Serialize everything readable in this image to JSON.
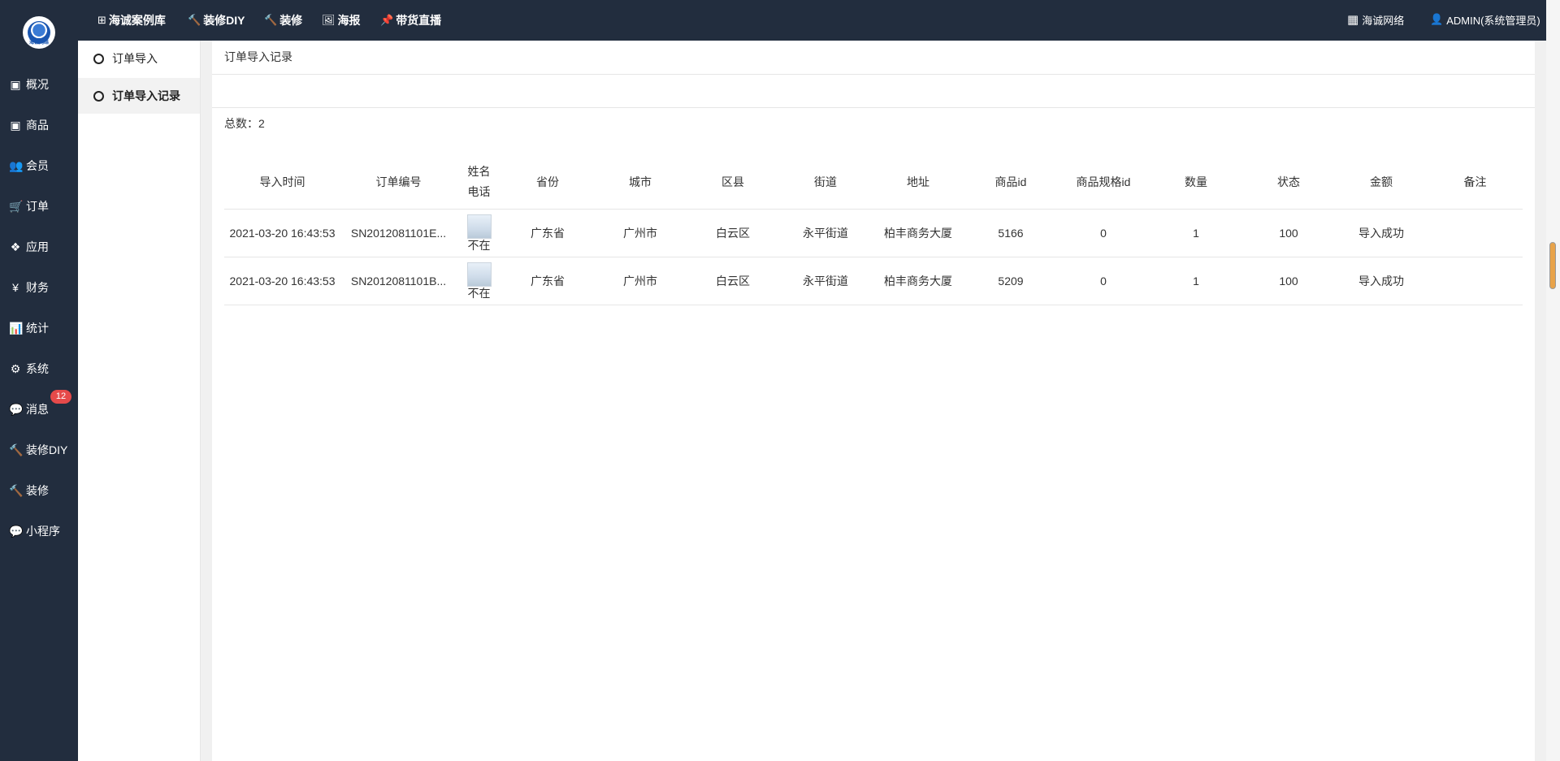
{
  "sidebar": {
    "logo_text": "海诚网络",
    "items": [
      {
        "label": "概况",
        "icon": "archive-icon",
        "glyph": "▣"
      },
      {
        "label": "商品",
        "icon": "box-icon",
        "glyph": "▣"
      },
      {
        "label": "会员",
        "icon": "users-icon",
        "glyph": "👥"
      },
      {
        "label": "订单",
        "icon": "cart-icon",
        "glyph": "🛒"
      },
      {
        "label": "应用",
        "icon": "cubes-icon",
        "glyph": "❖"
      },
      {
        "label": "财务",
        "icon": "yen-icon",
        "glyph": "¥"
      },
      {
        "label": "统计",
        "icon": "bar-chart-icon",
        "glyph": "📊"
      },
      {
        "label": "系统",
        "icon": "gears-icon",
        "glyph": "⚙"
      },
      {
        "label": "消息",
        "icon": "chat-icon",
        "glyph": "💬"
      },
      {
        "label": "装修DIY",
        "icon": "gavel-icon",
        "glyph": "🔨"
      },
      {
        "label": "装修",
        "icon": "gavel-icon",
        "glyph": "🔨"
      },
      {
        "label": "小程序",
        "icon": "wechat-icon",
        "glyph": "💬"
      }
    ],
    "message_badge": "12"
  },
  "topbar": {
    "links": [
      {
        "label": "海诚案例库",
        "icon": "plus-square-icon",
        "glyph": "⊞"
      },
      {
        "label": "装修DIY",
        "icon": "gavel-icon",
        "glyph": "🔨"
      },
      {
        "label": "装修",
        "icon": "gavel-icon",
        "glyph": "🔨"
      },
      {
        "label": "海报",
        "icon": "image-icon",
        "glyph": "🖼"
      },
      {
        "label": "带货直播",
        "icon": "pin-icon",
        "glyph": "📌"
      }
    ],
    "brand": "海诚网络",
    "user": "ADMIN(系统管理员)"
  },
  "subnav": {
    "items": [
      {
        "label": "订单导入",
        "active": false
      },
      {
        "label": "订单导入记录",
        "active": true
      }
    ]
  },
  "main": {
    "breadcrumb": "订单导入记录",
    "total": "总数：2",
    "columns": [
      "导入时间",
      "订单编号",
      "姓名",
      "电话",
      "省份",
      "城市",
      "区县",
      "街道",
      "地址",
      "商品id",
      "商品规格id",
      "数量",
      "状态",
      "金额",
      "备注"
    ],
    "rows": [
      {
        "time": "2021-03-20 16:43:53",
        "order_no": "SN2012081101E...",
        "image_alt": "不在",
        "province": "广东省",
        "city": "广州市",
        "district": "白云区",
        "street": "永平街道",
        "address": "柏丰商务大厦",
        "goods_id": "5166",
        "spec_id": "0",
        "qty": "1",
        "status": "100",
        "amount": "导入成功",
        "remark": ""
      },
      {
        "time": "2021-03-20 16:43:53",
        "order_no": "SN2012081101B...",
        "image_alt": "不在",
        "province": "广东省",
        "city": "广州市",
        "district": "白云区",
        "street": "永平街道",
        "address": "柏丰商务大厦",
        "goods_id": "5209",
        "spec_id": "0",
        "qty": "1",
        "status": "100",
        "amount": "导入成功",
        "remark": ""
      }
    ]
  }
}
